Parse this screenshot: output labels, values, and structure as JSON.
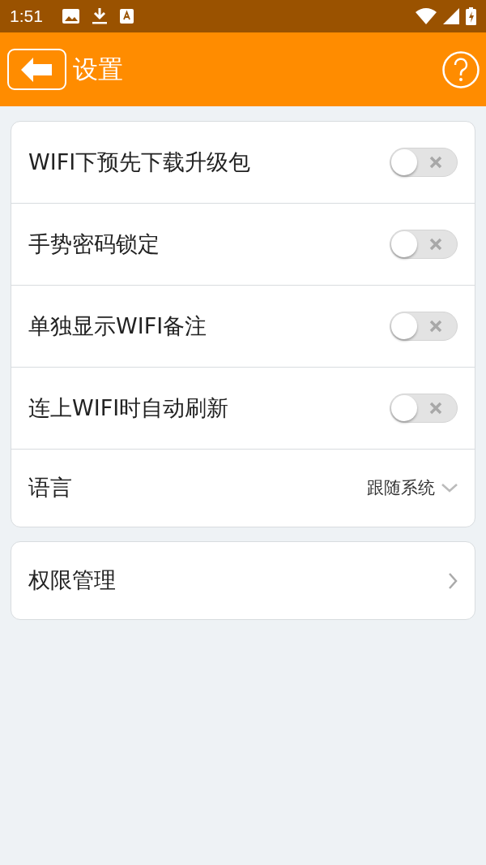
{
  "status_bar": {
    "time": "1:51"
  },
  "header": {
    "title": "设置"
  },
  "groups": [
    {
      "items": [
        {
          "kind": "toggle",
          "label": "WIFI下预先下载升级包",
          "on": false
        },
        {
          "kind": "toggle",
          "label": "手势密码锁定",
          "on": false
        },
        {
          "kind": "toggle",
          "label": "单独显示WIFI备注",
          "on": false
        },
        {
          "kind": "toggle",
          "label": "连上WIFI时自动刷新",
          "on": false
        },
        {
          "kind": "select",
          "label": "语言",
          "value": "跟随系统"
        }
      ]
    },
    {
      "items": [
        {
          "kind": "link",
          "label": "权限管理"
        }
      ]
    }
  ]
}
